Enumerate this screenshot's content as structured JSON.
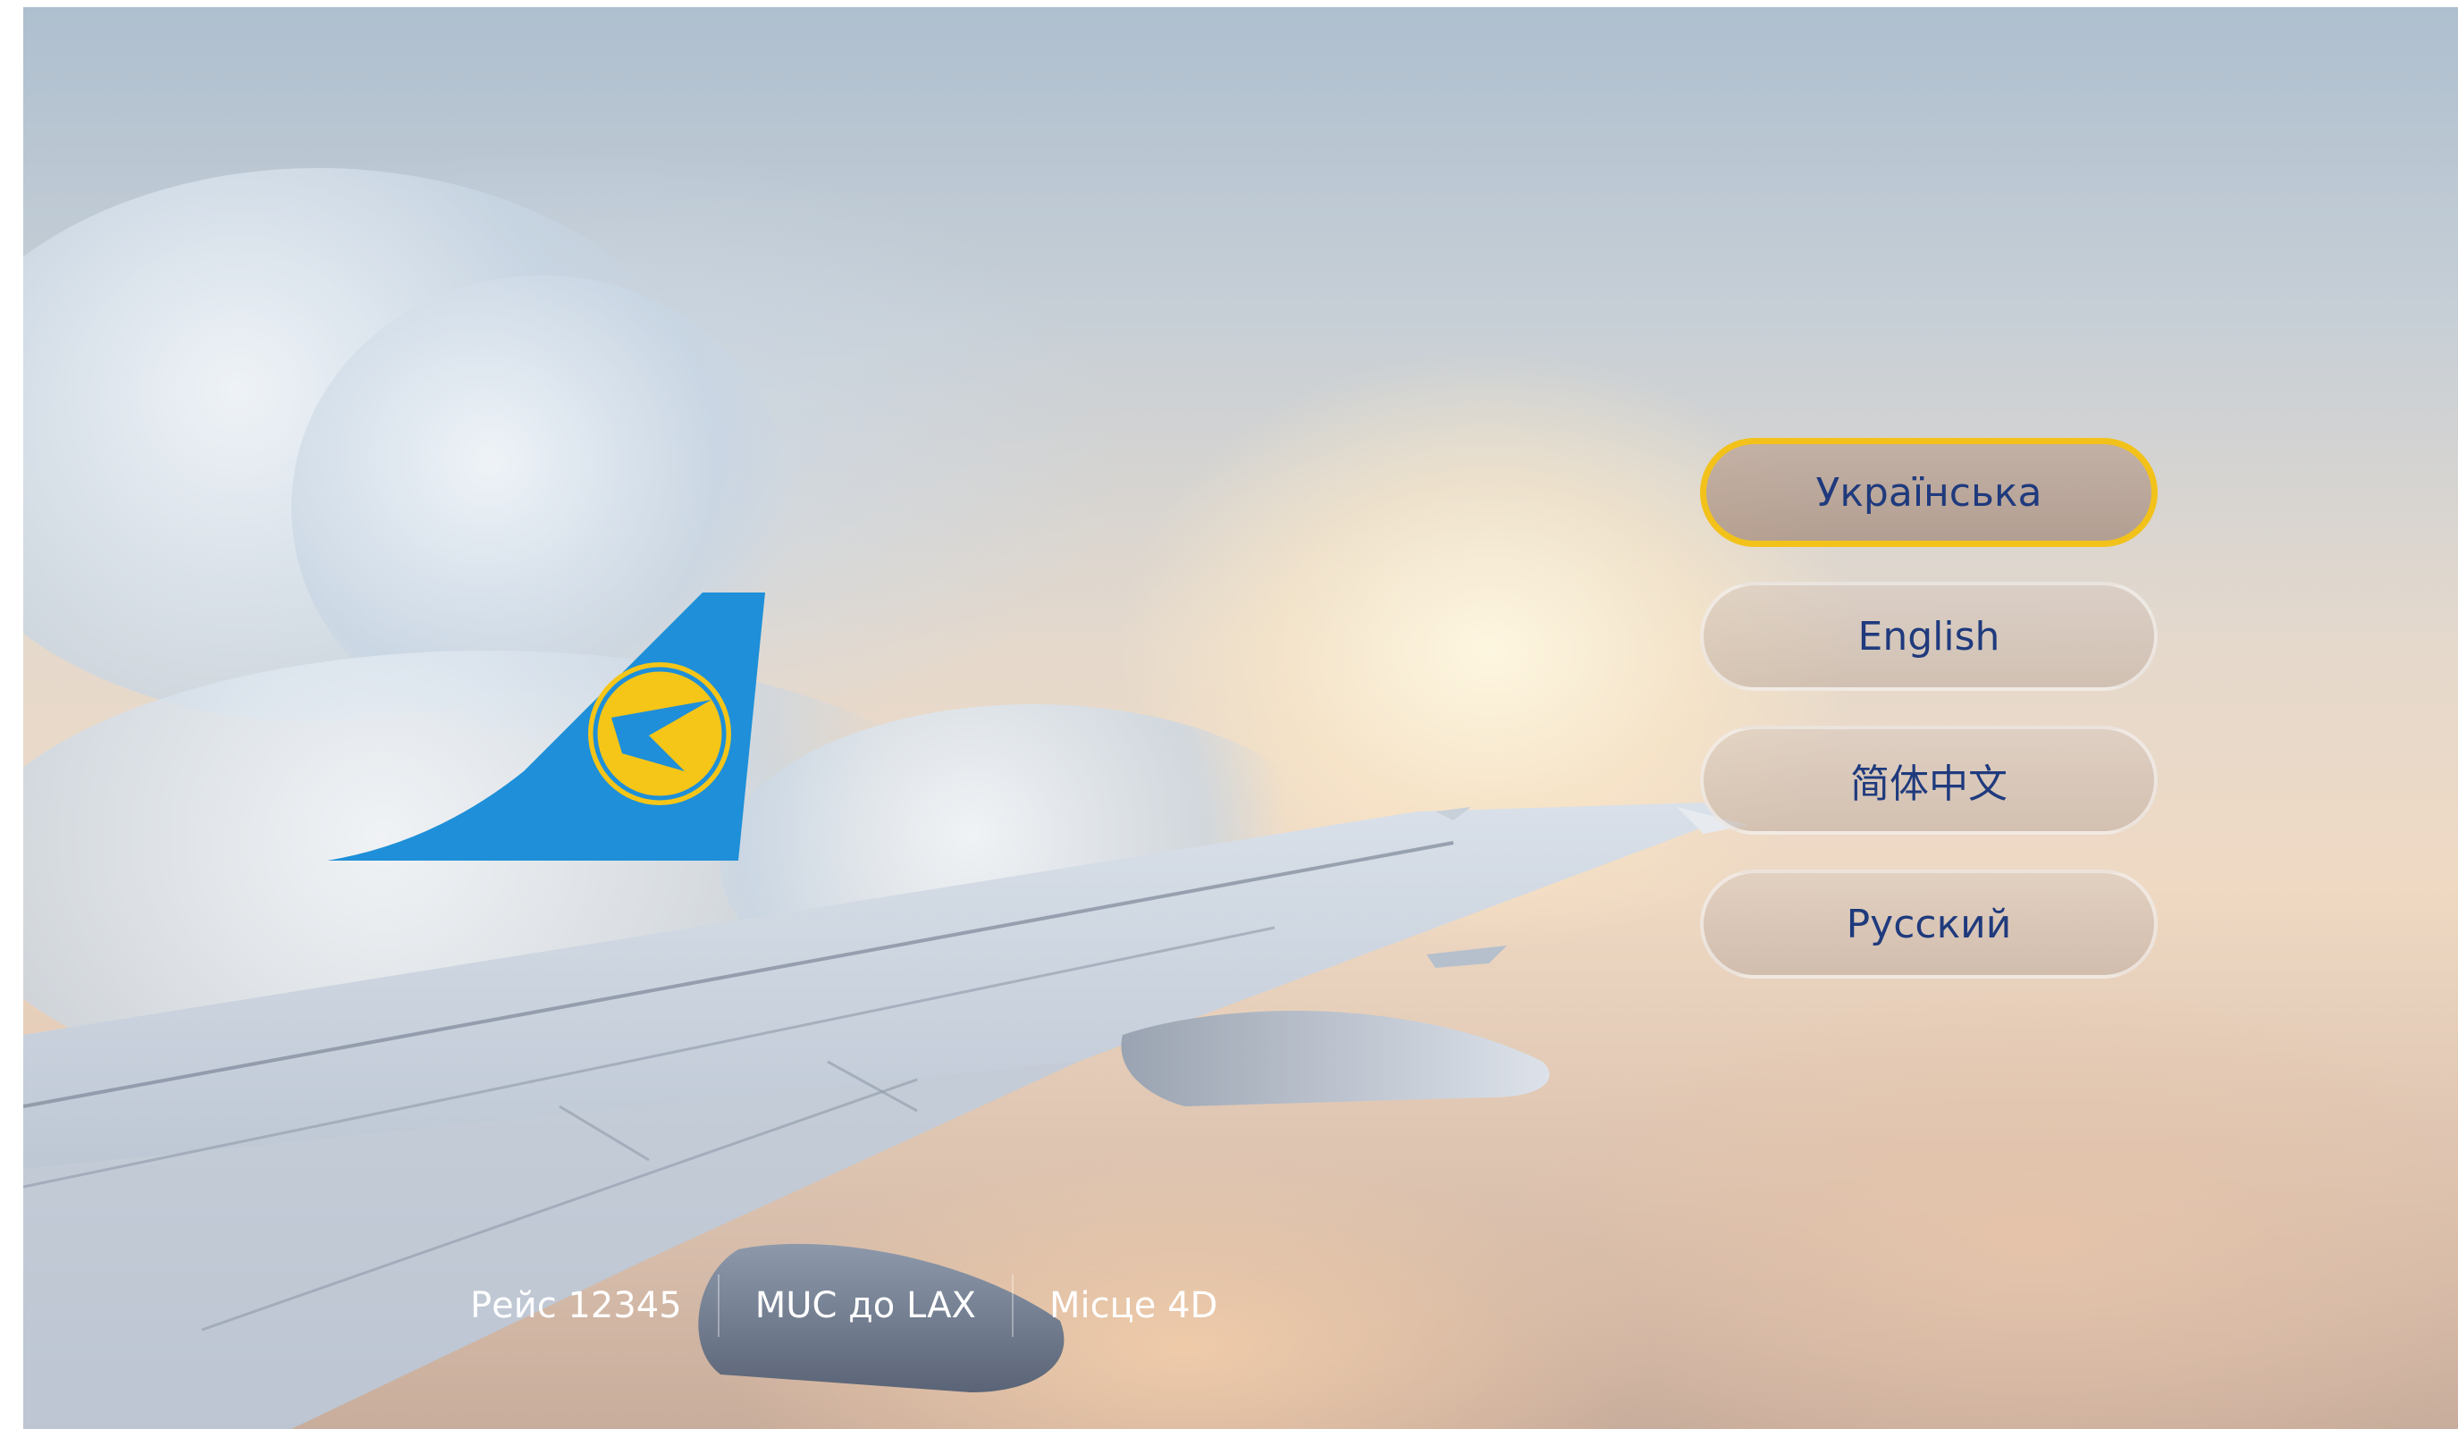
{
  "brand": {
    "logo_icon": "airline-tail-logo-icon",
    "tail_color": "#1e8fd8",
    "emblem_color": "#f5c518"
  },
  "languages": {
    "selected_border_color": "#f2c21a",
    "items": [
      {
        "label": "Українська",
        "selected": true
      },
      {
        "label": "English",
        "selected": false
      },
      {
        "label": "简体中文",
        "selected": false
      },
      {
        "label": "Русский",
        "selected": false
      }
    ]
  },
  "flight_info": {
    "flight": "Рейс 12345",
    "route": "MUC до LAX",
    "seat": "Місце 4D"
  }
}
